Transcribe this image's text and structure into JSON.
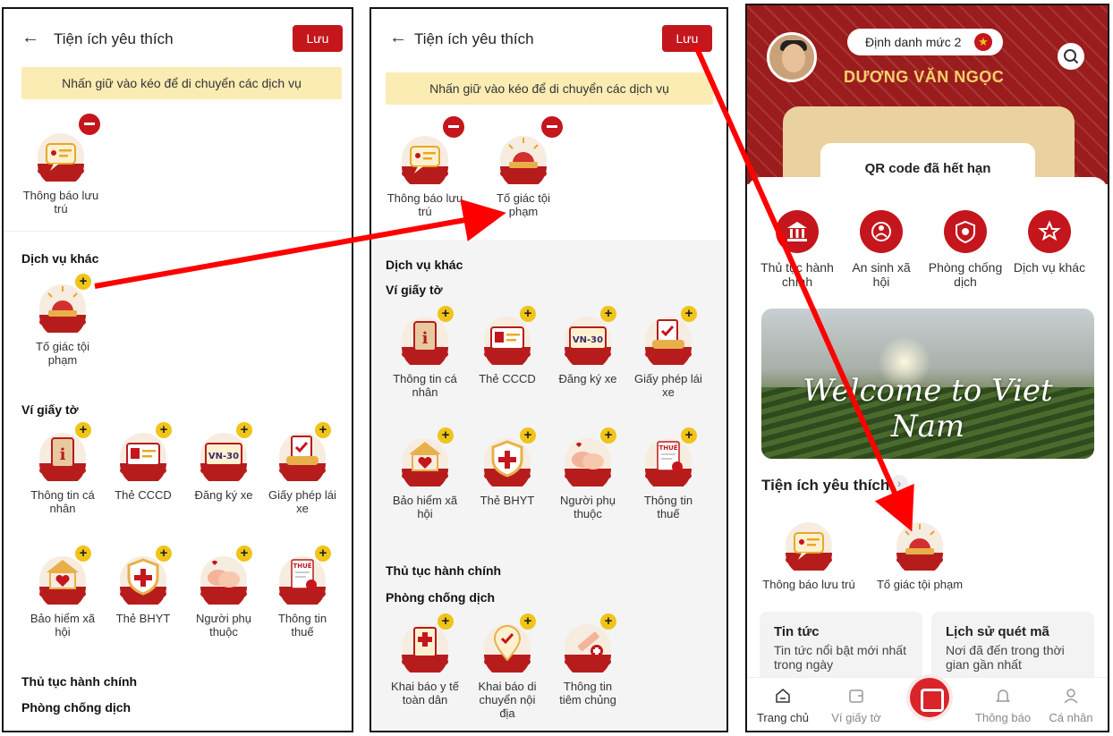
{
  "edit_screen": {
    "title": "Tiện ích yêu thích",
    "back_icon": "arrow-left-icon",
    "save_label": "Lưu",
    "hint": "Nhấn giữ vào kéo để di chuyển các dịch vụ"
  },
  "panel1": {
    "favorites": [
      {
        "label": "Thông báo lưu trú",
        "icon": "notice-residence-icon"
      }
    ],
    "other_services_title": "Dịch vụ khác",
    "other_services": [
      {
        "label": "Tố giác tội phạm",
        "icon": "siren-icon"
      }
    ],
    "wallet_title": "Ví giấy tờ",
    "wallet_items": [
      {
        "label": "Thông tin cá nhân",
        "icon": "personal-info-icon"
      },
      {
        "label": "Thẻ CCCD",
        "icon": "id-card-icon"
      },
      {
        "label": "Đăng ký xe",
        "icon": "vehicle-plate-icon"
      },
      {
        "label": "Giấy phép lái xe",
        "icon": "driver-license-icon"
      },
      {
        "label": "Bảo hiểm xã hội",
        "icon": "social-insurance-icon"
      },
      {
        "label": "Thẻ BHYT",
        "icon": "health-insurance-icon"
      },
      {
        "label": "Người phụ thuộc",
        "icon": "dependents-icon"
      },
      {
        "label": "Thông tin thuế",
        "icon": "tax-icon"
      }
    ],
    "admin_title": "Thủ tục hành chính",
    "epidemic_title": "Phòng chống dịch"
  },
  "panel2": {
    "favorites": [
      {
        "label": "Thông báo lưu trú",
        "icon": "notice-residence-icon"
      },
      {
        "label": "Tố giác tội phạm",
        "icon": "siren-icon"
      }
    ],
    "other_services_title": "Dịch vụ khác",
    "wallet_title": "Ví giấy tờ",
    "wallet_items": [
      {
        "label": "Thông tin cá nhân",
        "icon": "personal-info-icon"
      },
      {
        "label": "Thẻ CCCD",
        "icon": "id-card-icon"
      },
      {
        "label": "Đăng ký xe",
        "icon": "vehicle-plate-icon"
      },
      {
        "label": "Giấy phép lái xe",
        "icon": "driver-license-icon"
      },
      {
        "label": "Bảo hiểm xã hội",
        "icon": "social-insurance-icon"
      },
      {
        "label": "Thẻ BHYT",
        "icon": "health-insurance-icon"
      },
      {
        "label": "Người phụ thuộc",
        "icon": "dependents-icon"
      },
      {
        "label": "Thông tin thuế",
        "icon": "tax-icon"
      }
    ],
    "admin_title": "Thủ tục hành chính",
    "epidemic_title": "Phòng chống dịch",
    "epidemic_items": [
      {
        "label": "Khai báo y tế toàn dân",
        "icon": "health-declaration-icon"
      },
      {
        "label": "Khai báo di chuyển nội địa",
        "icon": "location-check-icon"
      },
      {
        "label": "Thông tin tiêm chủng",
        "icon": "vaccine-icon"
      }
    ]
  },
  "home": {
    "id_level": "Định danh mức 2",
    "user_name": "DƯƠNG VĂN NGỌC",
    "qr_status": "QR code đã hết hạn",
    "categories": [
      {
        "label": "Thủ tục hành chính",
        "icon": "government-building-icon"
      },
      {
        "label": "An sinh xã hội",
        "icon": "social-welfare-icon"
      },
      {
        "label": "Phòng chống dịch",
        "icon": "virus-shield-icon"
      },
      {
        "label": "Dịch vụ khác",
        "icon": "star-box-icon"
      }
    ],
    "banner_text": "Welcome to Viet Nam",
    "favorites_title": "Tiện ích yêu thích",
    "favorites": [
      {
        "label": "Thông báo lưu trú",
        "icon": "notice-residence-icon"
      },
      {
        "label": "Tố giác tội phạm",
        "icon": "siren-icon"
      }
    ],
    "cards": [
      {
        "title": "Tin tức",
        "subtitle": "Tin tức nổi bật mới nhất trong ngày"
      },
      {
        "title": "Lịch sử quét mã",
        "subtitle": "Nơi đã đến trong thời gian gần nhất"
      }
    ],
    "nav": [
      {
        "label": "Trang chủ",
        "icon": "home-icon"
      },
      {
        "label": "Ví giấy tờ",
        "icon": "wallet-icon"
      },
      {
        "label": "",
        "icon": "qr-scan-icon"
      },
      {
        "label": "Thông báo",
        "icon": "bell-icon"
      },
      {
        "label": "Cá nhân",
        "icon": "person-icon"
      }
    ]
  },
  "colors": {
    "brand_red": "#c4161c",
    "hint_yellow": "#fbecb4",
    "badge_yellow": "#f0c419",
    "arrow_red": "#ff0000"
  }
}
